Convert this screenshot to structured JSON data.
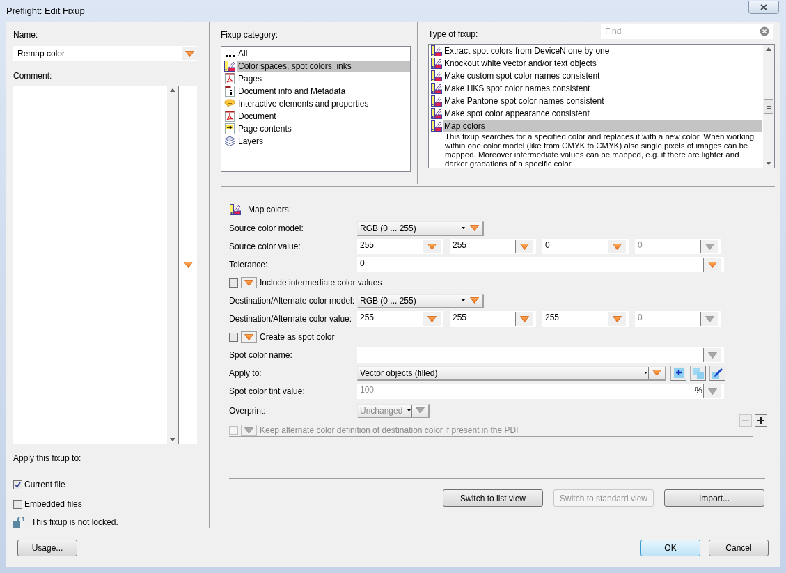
{
  "window": {
    "title": "Preflight: Edit Fixup"
  },
  "left": {
    "name_label": "Name:",
    "name_value": "Remap color",
    "comment_label": "Comment:",
    "apply_label": "Apply this fixup to:",
    "apply_options": [
      {
        "label": "Current file",
        "checked": true
      },
      {
        "label": "Embedded files",
        "checked": false
      }
    ],
    "lock_text": "This fixup is not locked.",
    "usage_button": "Usage..."
  },
  "category": {
    "label": "Fixup category:",
    "items": [
      {
        "label": "All",
        "kind": "dots",
        "selected": false
      },
      {
        "label": "Color spaces, spot colors, inks",
        "kind": "color",
        "selected": true
      },
      {
        "label": "Pages",
        "kind": "pdf",
        "selected": false
      },
      {
        "label": "Document info and Metadata",
        "kind": "info",
        "selected": false
      },
      {
        "label": "Interactive elements and properties",
        "kind": "comment",
        "selected": false
      },
      {
        "label": "Document",
        "kind": "pdf",
        "selected": false
      },
      {
        "label": "Page contents",
        "kind": "arrow",
        "selected": false
      },
      {
        "label": "Layers",
        "kind": "layers",
        "selected": false
      }
    ]
  },
  "type": {
    "label": "Type of fixup:",
    "find_placeholder": "Find",
    "items": [
      {
        "label": "Extract spot colors from DeviceN one by one",
        "selected": false
      },
      {
        "label": "Knockout white vector and/or text objects",
        "selected": false
      },
      {
        "label": "Make custom spot color names consistent",
        "selected": false
      },
      {
        "label": "Make HKS spot color names consistent",
        "selected": false
      },
      {
        "label": "Make Pantone spot color names consistent",
        "selected": false
      },
      {
        "label": "Make spot color appearance consistent",
        "selected": false
      },
      {
        "label": "Map colors",
        "selected": true,
        "description": "This fixup searches for a specified color and replaces it with a new color. When working within one color model (like from CMYK to CMYK) also single pixels of images can be mapped. Moreover intermediate values can be mapped, e.g. if there are lighter and darker gradations of a specific color."
      }
    ]
  },
  "form": {
    "title": "Map colors:",
    "rows": [
      {
        "kind": "select",
        "label": "Source color model:",
        "value": "RGB (0 ... 255)"
      },
      {
        "kind": "values",
        "label": "Source color value:",
        "fields": [
          {
            "value": "255",
            "disabled": false
          },
          {
            "value": "255",
            "disabled": false
          },
          {
            "value": "0",
            "disabled": false
          },
          {
            "value": "0",
            "disabled": true
          }
        ]
      },
      {
        "kind": "text",
        "label": "Tolerance:",
        "value": "0",
        "disabled": false
      },
      {
        "kind": "checkbox",
        "label": "Include intermediate color values",
        "checked": false,
        "disabled": false
      },
      {
        "kind": "select",
        "label": "Destination/Alternate color model:",
        "value": "RGB (0 ... 255)"
      },
      {
        "kind": "values",
        "label": "Destination/Alternate color value:",
        "fields": [
          {
            "value": "255",
            "disabled": false
          },
          {
            "value": "255",
            "disabled": false
          },
          {
            "value": "255",
            "disabled": false
          },
          {
            "value": "0",
            "disabled": true
          }
        ]
      },
      {
        "kind": "checkbox",
        "label": "Create as spot color",
        "checked": false,
        "disabled": false
      },
      {
        "kind": "text",
        "label": "Spot color name:",
        "disabled": true
      },
      {
        "kind": "apply",
        "label": "Apply to:",
        "value": "Vector objects (filled)"
      },
      {
        "kind": "text",
        "label": "Spot color tint value:",
        "value": "100",
        "unit": "%",
        "disabled": true
      },
      {
        "kind": "overprint",
        "label": "Overprint:",
        "value": "Unchanged",
        "disabled": true
      },
      {
        "kind": "checkbox",
        "label": "Keep alternate color definition of destination color if present in the PDF",
        "checked": false,
        "disabled": true
      }
    ],
    "remove_disabled": true,
    "add_disabled": false
  },
  "view_buttons": [
    {
      "label": "Switch to list view",
      "disabled": false
    },
    {
      "label": "Switch to standard view",
      "disabled": true
    },
    {
      "label": "Import...",
      "disabled": false
    }
  ],
  "dialog_buttons": [
    {
      "label": "OK",
      "default": true
    },
    {
      "label": "Cancel",
      "default": false
    }
  ]
}
